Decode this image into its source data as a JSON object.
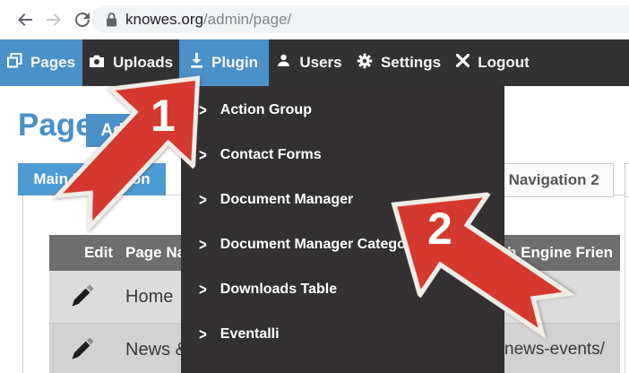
{
  "browser": {
    "url_host": "knowes.org",
    "url_path": "/admin/page/"
  },
  "navbar": {
    "items": [
      {
        "label": "Pages",
        "icon": "pages-icon",
        "active": true
      },
      {
        "label": "Uploads",
        "icon": "camera-icon",
        "active": false
      },
      {
        "label": "Plugin",
        "icon": "download-icon",
        "active": true
      },
      {
        "label": "Users",
        "icon": "user-icon",
        "active": false
      },
      {
        "label": "Settings",
        "icon": "gear-icon",
        "active": false
      },
      {
        "label": "Logout",
        "icon": "x-icon",
        "active": false
      }
    ]
  },
  "page": {
    "title": "Page",
    "add_button_label": "Add"
  },
  "tabs": {
    "active_label": "Main Navigation",
    "right_partial_label": "r Navigation 2"
  },
  "plugin_menu": {
    "chevron": ">",
    "items": [
      {
        "label": "Action Group"
      },
      {
        "label": "Contact Forms"
      },
      {
        "label": "Document Manager"
      },
      {
        "label": "Document Manager Categories"
      },
      {
        "label": "Downloads Table"
      },
      {
        "label": "Eventalli"
      }
    ]
  },
  "table": {
    "headers": {
      "edit": "Edit",
      "page_name": "Page Nam",
      "seo": "h Engine Frien"
    },
    "rows": [
      {
        "name": "Home",
        "seo": ""
      },
      {
        "name": "News &",
        "seo": "news-events/"
      }
    ]
  },
  "annotations": {
    "step1": "1",
    "step2": "2"
  },
  "colors": {
    "accent_blue": "#4a90c9",
    "nav_dark": "#333233",
    "arrow_red": "#d5382e",
    "table_header_grey": "#6e6e6e",
    "address_bar_grey": "#f1f3f4"
  }
}
